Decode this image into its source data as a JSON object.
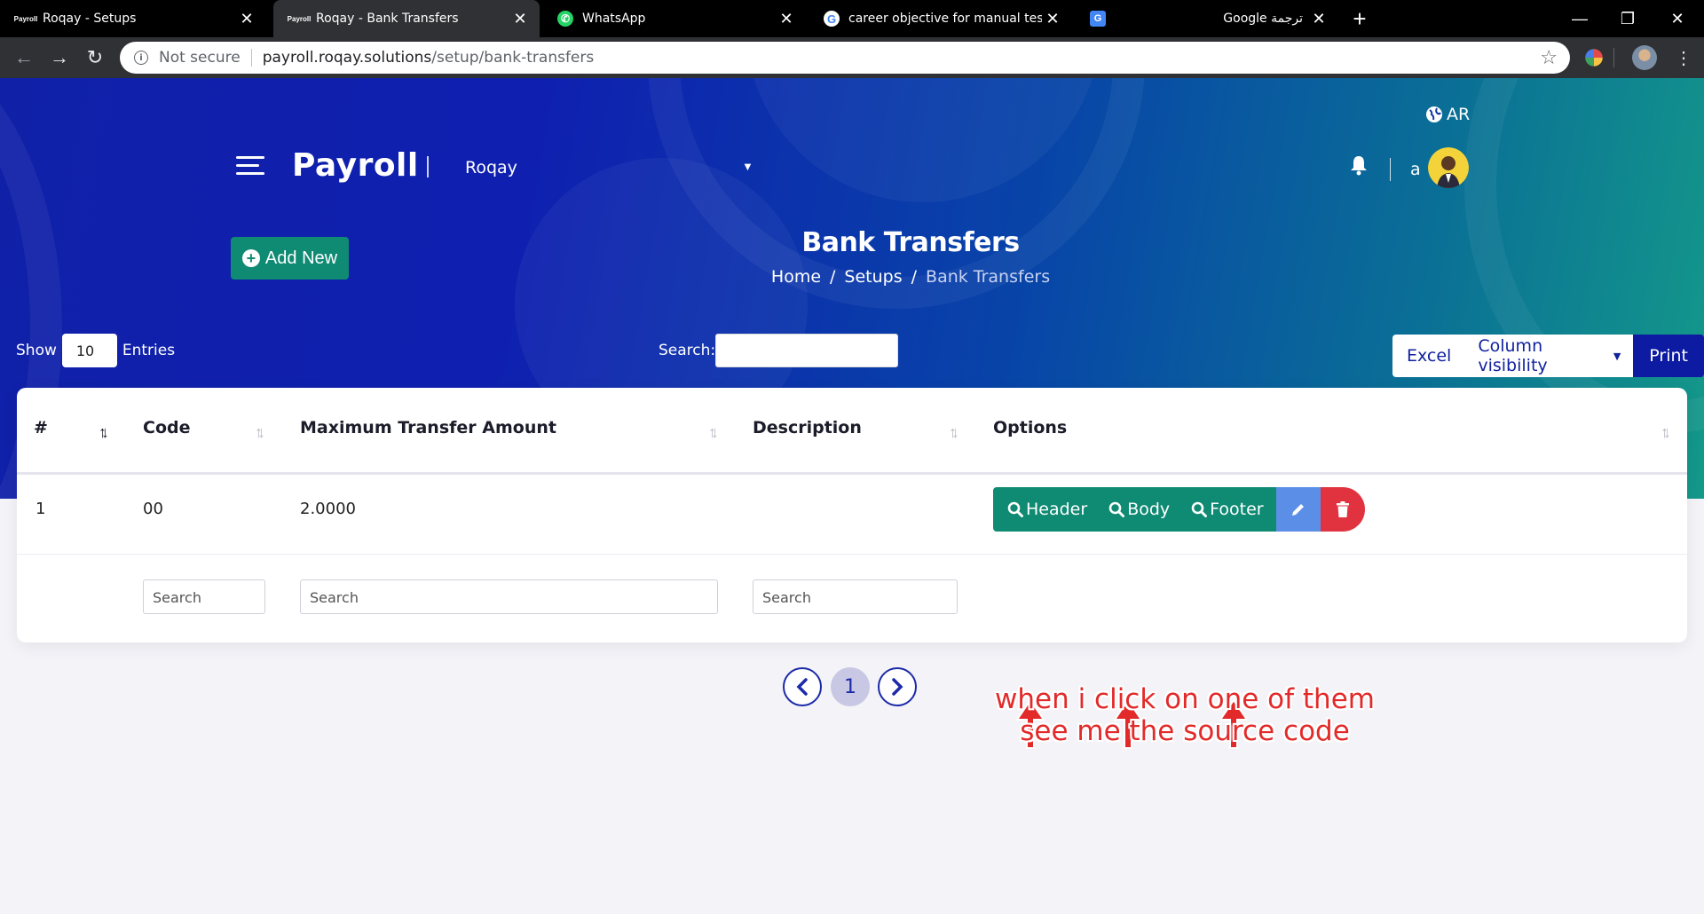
{
  "browser": {
    "tabs": [
      {
        "title": "Roqay - Setups",
        "favicon": "Payroll"
      },
      {
        "title": "Roqay - Bank Transfers",
        "favicon": "Payroll"
      },
      {
        "title": "WhatsApp"
      },
      {
        "title": "career objective for manual testin"
      },
      {
        "title": "Google ترجمة"
      }
    ],
    "url_security": "Not secure",
    "url_host": "payroll.roqay.solutions",
    "url_path": "/setup/bank-transfers"
  },
  "header": {
    "brand": "Payroll",
    "company": "Roqay",
    "lang": "AR",
    "user": "a"
  },
  "page": {
    "add_new": "Add New",
    "title": "Bank Transfers",
    "breadcrumb": [
      "Home",
      "Setups",
      "Bank Transfers"
    ]
  },
  "table_controls": {
    "show_label": "Show",
    "entries_value": "10",
    "entries_label": "Entries",
    "search_label": "Search:",
    "excel": "Excel",
    "column_visibility": "Column visibility",
    "print": "Print"
  },
  "table": {
    "columns": [
      "#",
      "Code",
      "Maximum Transfer Amount",
      "Description",
      "Options"
    ],
    "rows": [
      {
        "num": "1",
        "code": "00",
        "max_amount": "2.0000",
        "description": ""
      }
    ],
    "row_actions": {
      "header": "Header",
      "body": "Body",
      "footer": "Footer"
    },
    "column_search_placeholder": "Search"
  },
  "pagination": {
    "current": "1"
  },
  "annotation": {
    "line1": "when i click on one of them",
    "line2": "see me the source code"
  },
  "colors": {
    "teal": "#0f8a73",
    "navy": "#0d1aa2",
    "edit_blue": "#5b8ee6",
    "delete_red": "#e1333f"
  }
}
